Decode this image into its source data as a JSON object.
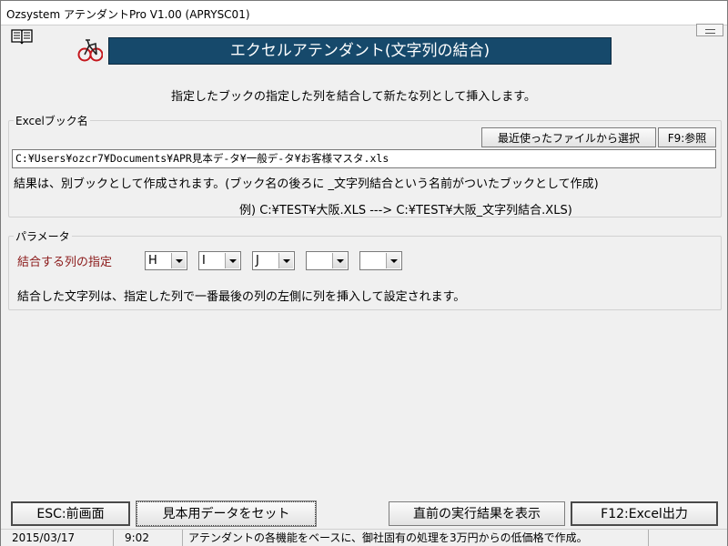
{
  "window": {
    "title": "Ozsystem アテンダントPro V1.00 (APRYSC01)"
  },
  "header": {
    "banner": "エクセルアテンダント(文字列の結合)",
    "instruction": "指定したブックの指定した列を結合して新たな列として挿入します。"
  },
  "excel_book": {
    "group_label": "Excelブック名",
    "recent_button": "最近使ったファイルから選択",
    "browse_button": "F9:参照",
    "path_value": "C:¥Users¥ozcr7¥Documents¥APR見本デ-タ¥一般デ-タ¥お客様マスタ.xls",
    "note": "結果は、別ブックとして作成されます。(ブック名の後ろに _文字列結合という名前がついたブックとして作成)",
    "example": "例) C:¥TEST¥大阪.XLS    --->    C:¥TEST¥大阪_文字列結合.XLS)"
  },
  "parameters": {
    "group_label": "パラメータ",
    "columns_label": "結合する列の指定",
    "columns": [
      "H",
      "I",
      "J",
      "",
      ""
    ],
    "note": "結合した文字列は、指定した列で一番最後の列の左側に列を挿入して設定されます。"
  },
  "buttons": {
    "esc": "ESC:前画面",
    "sample": "見本用データをセット",
    "last_result": "直前の実行結果を表示",
    "excel_output": "F12:Excel出力"
  },
  "status": {
    "date": "2015/03/17",
    "time": "9:02",
    "message": "アテンダントの各機能をベースに、御社固有の処理を3万円からの低価格で作成。"
  },
  "colors": {
    "banner_bg": "#16496b",
    "label_red": "#8b1a1a"
  },
  "icons": {
    "book": "open-book-icon",
    "bike": "bicycle-icon"
  }
}
